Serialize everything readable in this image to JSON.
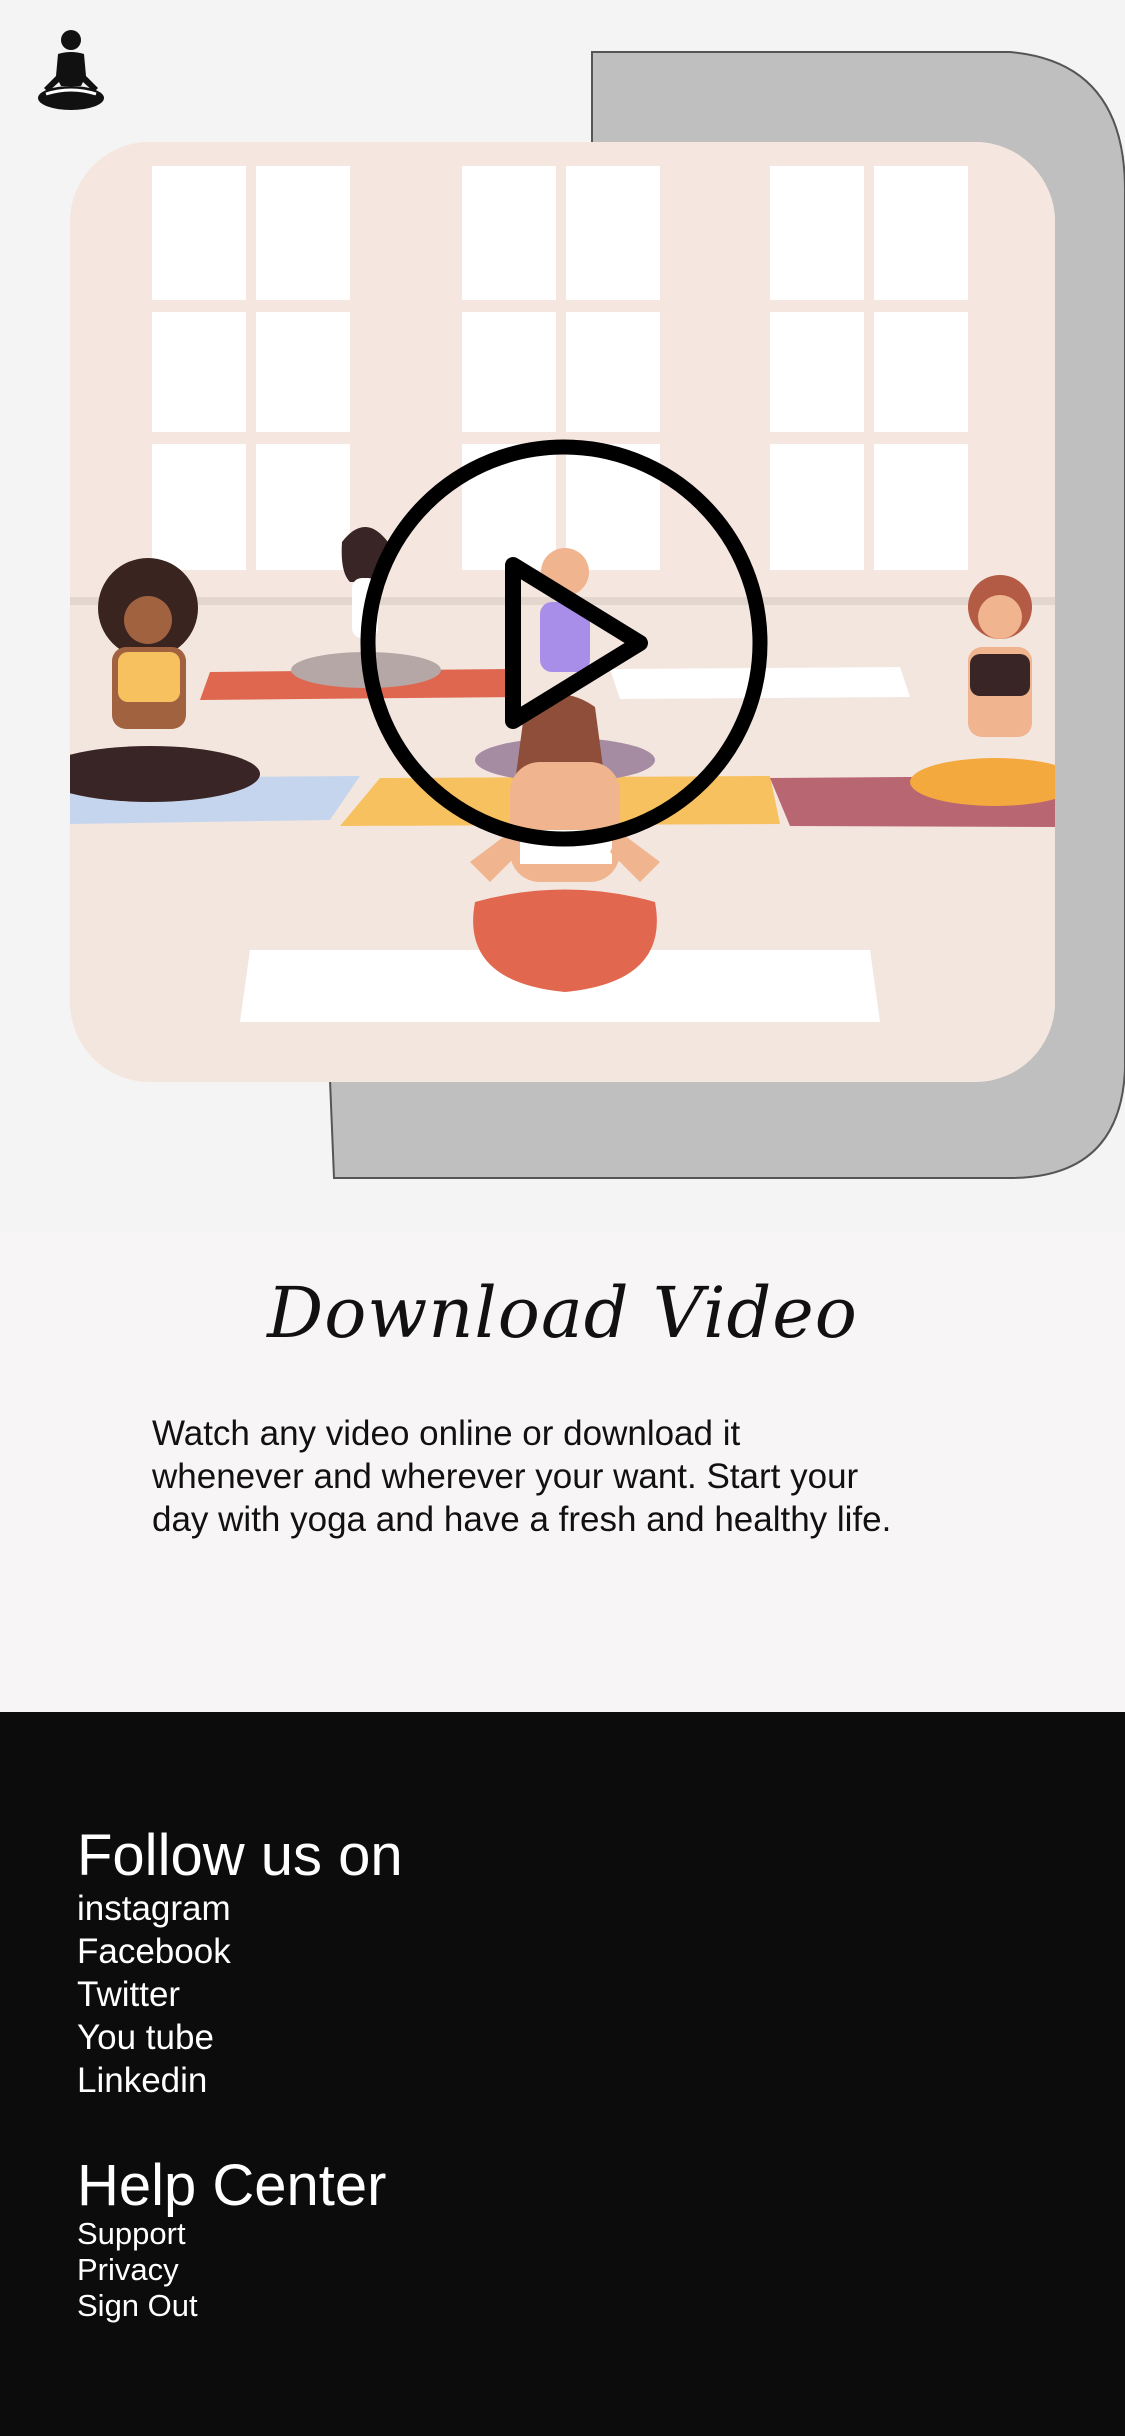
{
  "app": {
    "logo_icon": "meditation-person-icon"
  },
  "hero": {
    "play_icon": "play-circle-icon"
  },
  "info": {
    "title": "Download Video",
    "body": "Watch any video online or download it whenever and wherever your want. Start your day with yoga and have a fresh and healthy life."
  },
  "footer": {
    "follow_heading": "Follow us on",
    "follow_links": [
      "instagram",
      "Facebook",
      "Twitter",
      "You tube",
      "Linkedin"
    ],
    "help_heading": "Help Center",
    "help_links": [
      "Support",
      "Privacy",
      "Sign Out"
    ]
  },
  "colors": {
    "page_bg": "#f4f4f4",
    "card_shadow": "#bfbfbf",
    "video_bg": "#f3e6df",
    "footer_bg": "#0c0c0c",
    "footer_text": "#ffffff"
  }
}
